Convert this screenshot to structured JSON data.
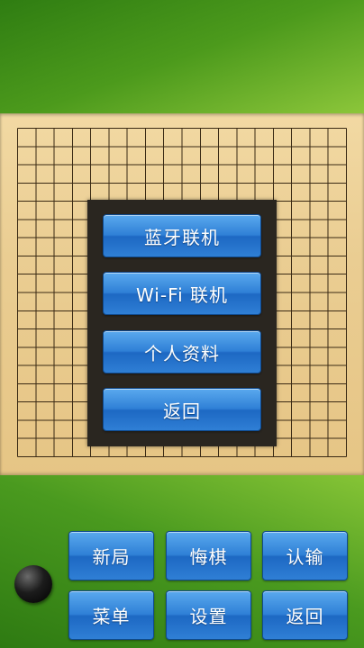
{
  "menu": {
    "bluetooth_label": "蓝牙联机",
    "wifi_label": "Wi-Fi 联机",
    "profile_label": "个人资料",
    "back_label": "返回"
  },
  "controls": {
    "new_game": "新局",
    "undo": "悔棋",
    "resign": "认输",
    "menu": "菜单",
    "settings": "设置",
    "back": "返回"
  },
  "colors": {
    "green_dark": "#2f7d12",
    "green_light": "#8cc63a",
    "board": "#eacd92",
    "button_blue": "#2f80d6"
  },
  "current_stone": "black"
}
